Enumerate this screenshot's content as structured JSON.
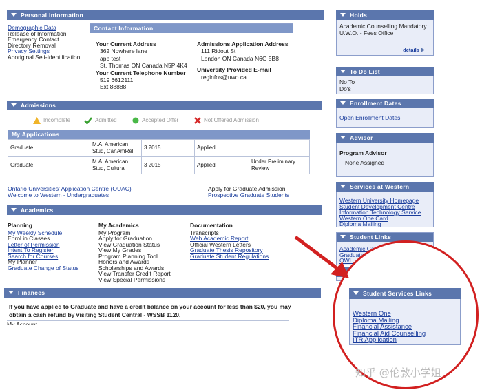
{
  "personal": {
    "header": "Personal Information",
    "links": [
      "Demographic Data",
      "Release of Information",
      "Emergency Contact",
      "Directory Removal",
      "Privacy Settings",
      "Aboriginal Self-Identification"
    ],
    "contact": {
      "title": "Contact Information",
      "current_address_label": "Your Current Address",
      "current_address": [
        "362 Nowhere lane",
        "app test",
        "St. Thomas ON Canada N5P 4K4"
      ],
      "phone_label": "Your Current Telephone Number",
      "phone": [
        "519 6612111",
        "Ext 88888"
      ],
      "admissions_address_label": "Admissions Application Address",
      "admissions_address": [
        "111 Ridout St",
        "London ON Canada N6G 5B8"
      ],
      "email_label": "University Provided E-mail",
      "email": "reginfos@uwo.ca"
    }
  },
  "admissions": {
    "header": "Admissions",
    "legend": {
      "incomplete": "Incomplete",
      "admitted": "Admitted",
      "accepted": "Accepted Offer",
      "not_offered": "Not Offered Admission"
    },
    "apps_header": "My Applications",
    "rows": [
      [
        "Graduate",
        "M.A. American Stud, CanAmRel",
        "3 2015",
        "Applied",
        ""
      ],
      [
        "Graduate",
        "M.A. American Stud, Cultural",
        "3 2015",
        "Applied",
        "Under Preliminary Review"
      ]
    ],
    "link_ouac": "Ontario Universities' Application Centre (OUAC)",
    "link_welcome": "Welcome to Western - Undergraduates",
    "apply_text": "Apply for Graduate Admission",
    "link_prospective": "Prospective Graduate Students"
  },
  "academics": {
    "header": "Academics",
    "planning": {
      "title": "Planning",
      "items": [
        "My Weekly Schedule",
        "Enrol in Classes",
        "Letter of Permission",
        "Intent To Register",
        "Search for Courses",
        "My Planner",
        "Graduate Change of Status"
      ]
    },
    "my_academics": {
      "title": "My Academics",
      "items": [
        "My Program",
        "Apply for Graduation",
        "View Graduation Status",
        "View My Grades",
        "Program Planning Tool",
        "Honors and Awards",
        "Scholarships and Awards",
        "View Transfer Credit Report",
        "View Special Permissions"
      ]
    },
    "documentation": {
      "title": "Documentation",
      "items": [
        "Transcripts",
        "Web Academic Report",
        "Official Western Letters",
        "Graduate Thesis Repository",
        "Graduate Student Regulations"
      ]
    }
  },
  "finances": {
    "header": "Finances",
    "notice": "If you have applied to Graduate and have a credit balance on your account for less than $20, you may obtain a cash refund by visiting Student Central - WSSB 1120.",
    "account_label": "My Account"
  },
  "side": {
    "holds": {
      "header": "Holds",
      "text": [
        "Academic Counselling Mandatory",
        "U.W.O. - Fees Office"
      ],
      "details": "details"
    },
    "todo": {
      "header": "To Do List",
      "items": [
        "No To",
        "Do's"
      ]
    },
    "enrollment": {
      "header": "Enrollment Dates",
      "link": "Open Enrollment Dates"
    },
    "advisor": {
      "header": "Advisor",
      "label": "Program Advisor",
      "value": "None Assigned"
    },
    "services": {
      "header": "Services at Western",
      "links": [
        "Western University Homepage",
        "Student Development Centre",
        "Information Technology Service",
        "Western One Card",
        "Diploma Mailing"
      ]
    },
    "student_links": {
      "header": "Student Links",
      "links": [
        "Academic Calendar",
        "Graduate Stu",
        "OWL"
      ]
    },
    "services_links": {
      "header": "Student Services Links",
      "links": [
        "Western One",
        "Diploma Mailing",
        "Financial Assistance",
        "Financial Aid Counselling",
        "ITR Application"
      ]
    }
  },
  "watermark": "知乎 @伦敦小学姐",
  "colors": {
    "header": "#5b76ad",
    "link": "#1a3d9c",
    "highlight": "#d22020",
    "side_bg": "#e9edf8"
  }
}
